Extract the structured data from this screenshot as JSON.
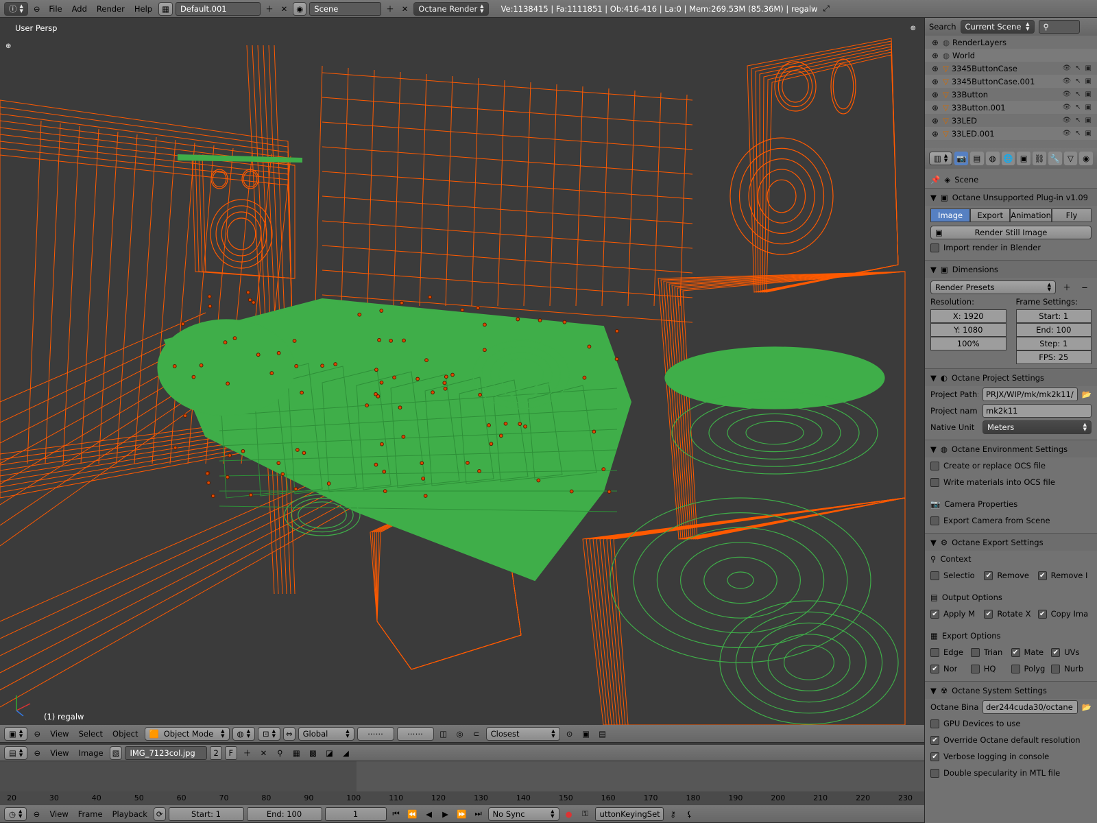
{
  "topbar": {
    "menus": [
      "File",
      "Add",
      "Render",
      "Help"
    ],
    "layout": "Default.001",
    "scene": "Scene",
    "engine": "Octane Render",
    "stats": "Ve:1138415 | Fa:1111851 | Ob:416-416 | La:0 | Mem:269.53M (85.36M) | regalw"
  },
  "viewport": {
    "label": "User Persp",
    "object_label": "(1) regalw"
  },
  "view3d_header": {
    "menus": [
      "View",
      "Select",
      "Object"
    ],
    "mode": "Object Mode",
    "orientation": "Global",
    "snap": "Closest"
  },
  "image_header": {
    "menus": [
      "View",
      "Image"
    ],
    "image": "IMG_7123col.jpg",
    "users": "2",
    "fake": "F"
  },
  "timeline": {
    "ticks": [
      "20",
      "30",
      "40",
      "50",
      "60",
      "70",
      "80",
      "90",
      "100",
      "110",
      "120",
      "130",
      "140",
      "150",
      "160",
      "170",
      "180",
      "190",
      "200",
      "210",
      "220",
      "230"
    ],
    "menus": [
      "View",
      "Frame",
      "Playback"
    ],
    "start": "Start: 1",
    "end": "End: 100",
    "current": "1",
    "sync": "No Sync",
    "keying_set": "uttonKeyingSet"
  },
  "outliner": {
    "search": "Search",
    "filter": "Current Scene",
    "items": [
      {
        "label": "RenderLayers"
      },
      {
        "label": "World"
      },
      {
        "label": "3345ButtonCase"
      },
      {
        "label": "3345ButtonCase.001"
      },
      {
        "label": "33Button"
      },
      {
        "label": "33Button.001"
      },
      {
        "label": "33LED"
      },
      {
        "label": "33LED.001"
      }
    ]
  },
  "properties": {
    "context": "Scene",
    "plugin_title": "Octane Unsupported Plug-in v1.09",
    "tabs": [
      "Image",
      "Export",
      "Animation",
      "Fly"
    ],
    "render_button": "Render Still Image",
    "import_render": "Import render in Blender",
    "dimensions": {
      "title": "Dimensions",
      "presets": "Render Presets",
      "resolution_label": "Resolution:",
      "res_x": "X: 1920",
      "res_y": "Y: 1080",
      "res_pct": "100%",
      "frame_label": "Frame Settings:",
      "start": "Start: 1",
      "end": "End: 100",
      "step": "Step: 1",
      "fps": "FPS: 25"
    },
    "project": {
      "title": "Octane Project Settings",
      "path_label": "Project Path:",
      "path_value": "PRJX/WIP/mk/mk2k11/",
      "name_label": "Project nam",
      "name_value": "mk2k11",
      "unit_label": "Native Unit",
      "unit_value": "Meters"
    },
    "environment": {
      "title": "Octane Environment Settings",
      "create_ocs": "Create or replace OCS file",
      "write_mat": "Write materials into OCS file",
      "camera_props": "Camera Properties",
      "export_camera": "Export Camera from Scene"
    },
    "export": {
      "title": "Octane Export Settings",
      "context": "Context",
      "row1": [
        {
          "label": "Selectio",
          "checked": false
        },
        {
          "label": "Remove",
          "checked": true
        },
        {
          "label": "Remove I",
          "checked": true
        }
      ],
      "output_options": "Output Options",
      "row2": [
        {
          "label": "Apply M",
          "checked": true
        },
        {
          "label": "Rotate X",
          "checked": true
        },
        {
          "label": "Copy Ima",
          "checked": true
        }
      ],
      "export_options": "Export Options",
      "row3": [
        {
          "label": "Edge",
          "checked": false
        },
        {
          "label": "Trian",
          "checked": false
        },
        {
          "label": "Mate",
          "checked": true
        },
        {
          "label": "UVs",
          "checked": true
        }
      ],
      "row4": [
        {
          "label": "Nor",
          "checked": true
        },
        {
          "label": "HQ",
          "checked": false
        },
        {
          "label": "Polyg",
          "checked": false
        },
        {
          "label": "Nurb",
          "checked": false
        }
      ]
    },
    "system": {
      "title": "Octane System Settings",
      "binary_label": "Octane Bina",
      "binary_value": "der244cuda30/octane",
      "gpu": "GPU Devices to use",
      "override": "Override Octane default resolution",
      "verbose": "Verbose logging in console",
      "double_spec": "Double specularity in MTL file"
    }
  },
  "colors": {
    "wire_orange": "#ff5a00",
    "wire_green": "#3fae49",
    "active_blue": "#5680c2",
    "panel_bg": "#727272",
    "viewport_bg": "#3b3b3b"
  }
}
